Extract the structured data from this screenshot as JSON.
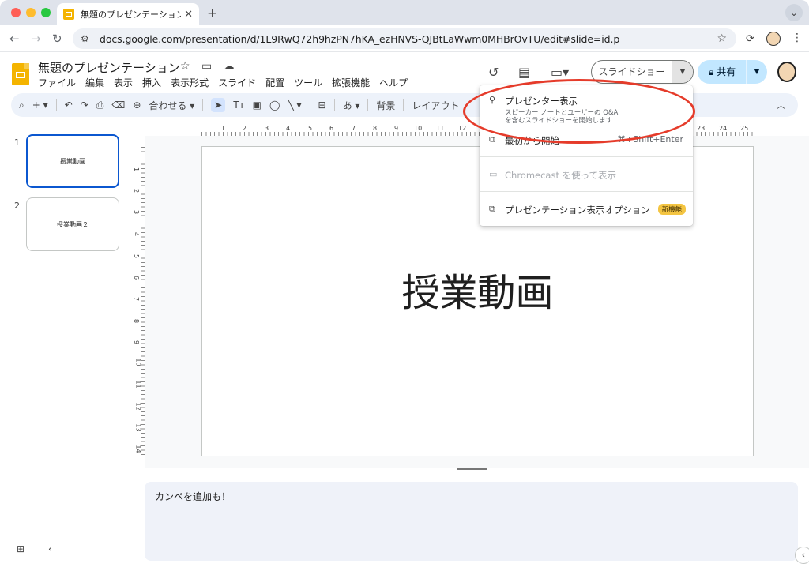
{
  "browser": {
    "tab_title": "無題のプレゼンテーション - Goo",
    "tab_close": "✕",
    "new_tab": "+",
    "url": "docs.google.com/presentation/d/1L9RwQ72h9hzPN7hKA_ezHNVS-QJBtLaWwm0MHBrOvTU/edit#slide=id.p"
  },
  "doc": {
    "title": "無題のプレゼンテーション",
    "menus": [
      "ファイル",
      "編集",
      "表示",
      "挿入",
      "表示形式",
      "スライド",
      "配置",
      "ツール",
      "拡張機能",
      "ヘルプ"
    ]
  },
  "header": {
    "slideshow_label": "スライドショー",
    "share_label": "共有"
  },
  "toolbar": {
    "zoom_label": "合わせる",
    "background_label": "背景",
    "layout_label": "レイアウト"
  },
  "ruler": {
    "h_ticks": [
      "1",
      "2",
      "3",
      "4",
      "5",
      "6",
      "7",
      "8",
      "9",
      "10",
      "11",
      "12",
      "23",
      "24",
      "25"
    ],
    "v_ticks": [
      "1",
      "2",
      "3",
      "4",
      "5",
      "6",
      "7",
      "8",
      "9",
      "10",
      "11",
      "12",
      "13",
      "14"
    ]
  },
  "filmstrip": {
    "slides": [
      {
        "number": "1",
        "title": "授業動画"
      },
      {
        "number": "2",
        "title": "授業動画２"
      }
    ]
  },
  "slide": {
    "main_text": "授業動画"
  },
  "notes": {
    "text": "カンペを追加も！"
  },
  "menu": {
    "presenter_view": "プレゼンター表示",
    "presenter_view_desc_1": "スピーカー ノートとユーザーの Q&A",
    "presenter_view_desc_2": "を含むスライドショーを開始します",
    "from_start": "最初から開始",
    "from_start_shortcut": "⌘+Shift+Enter",
    "chromecast": "Chromecast を使って表示",
    "options": "プレゼンテーション表示オプション",
    "new_badge": "新機能"
  },
  "colors": {
    "accent_blue": "#0b57d0",
    "share_bg": "#c2e7ff",
    "highlight_red": "#e53b2a",
    "slides_yellow": "#f4b400"
  }
}
